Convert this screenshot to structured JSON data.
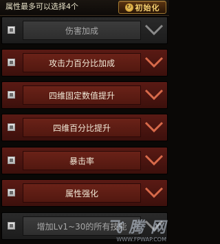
{
  "header": {
    "title": "属性最多可以选择4个",
    "reset_label": "初始化"
  },
  "attributes": [
    {
      "label": "伤害加成",
      "state": "disabled"
    },
    {
      "label": "攻击力百分比加成",
      "state": "active"
    },
    {
      "label": "四维固定数值提升",
      "state": "active"
    },
    {
      "label": "四维百分比提升",
      "state": "active"
    },
    {
      "label": "暴击率",
      "state": "active"
    },
    {
      "label": "属性强化",
      "state": "active"
    },
    {
      "label": "增加Lv1~30的所有技能",
      "state": "disabled"
    }
  ],
  "watermark": {
    "text": "飞 腾 网",
    "url": "WWW.FPWAP.COM"
  },
  "colors": {
    "active_row": "#5a1a14",
    "disabled_row": "#2a2a2a",
    "active_chevron": "#d86a4a",
    "disabled_chevron": "#8a8a8a",
    "reset_text": "#f4d070"
  }
}
